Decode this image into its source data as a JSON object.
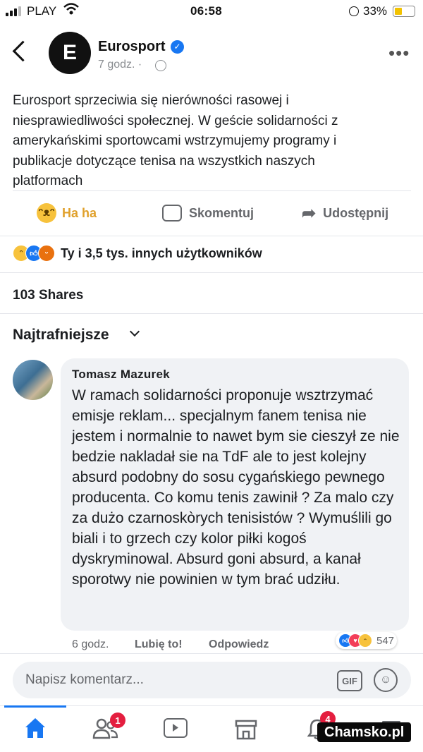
{
  "status_bar": {
    "carrier": "PLAY",
    "time": "06:58",
    "battery": "33%"
  },
  "header": {
    "page_name": "Eurosport",
    "post_time": "7 godz. ·",
    "logo_glyph": "E"
  },
  "post": {
    "text": "Eurosport sprzeciwia się nierówności rasowej i niesprawiedliwości społecznej. W geście solidarności z amerykańskimi sportowcami wstrzymujemy programy i publikacje dotyczące tenisa na wszystkich naszych platformach"
  },
  "actions": {
    "reaction_label": "Ha ha",
    "comment_label": "Skomentuj",
    "share_label": "Udostępnij"
  },
  "reactions_summary": {
    "icons": [
      "haha-icon",
      "like-icon",
      "angry-icon"
    ],
    "text": "Ty i 3,5 tys. innych użytkowników"
  },
  "shares": "103 Shares",
  "sort_label": "Najtrafniejsze",
  "comment": {
    "author": "Tomasz Mazurek",
    "text": "W ramach solidarności proponuje wsztrzymać emisje reklam... specjalnym fanem tenisa nie jestem i normalnie to nawet bym sie cieszył ze nie bedzie nakladał sie na TdF ale to jest kolejny absurd podobny do sosu cygańskiego pewnego producenta. Co komu tenis zawinił ? Za malo czy za dużo czarnoskòrych tenisistów ? Wymuślili go biali i to grzech czy kolor piłki kogoś dyskryminowal. Absurd goni absurd, a kanał sporotwy nie powinien w tym brać udziłu.",
    "time": "6 godz.",
    "like_label": "Lubię to!",
    "reply_label": "Odpowiedz",
    "reaction_count": "547"
  },
  "composer": {
    "placeholder": "Napisz komentarz...",
    "gif_label": "GIF"
  },
  "bottom_nav": {
    "friends_badge": "1",
    "notifications_badge": "4"
  },
  "watermark": "Chamsko.pl",
  "colors": {
    "accent": "#1877f2",
    "haha": "#f7c23c",
    "badge": "#e41e3f"
  }
}
